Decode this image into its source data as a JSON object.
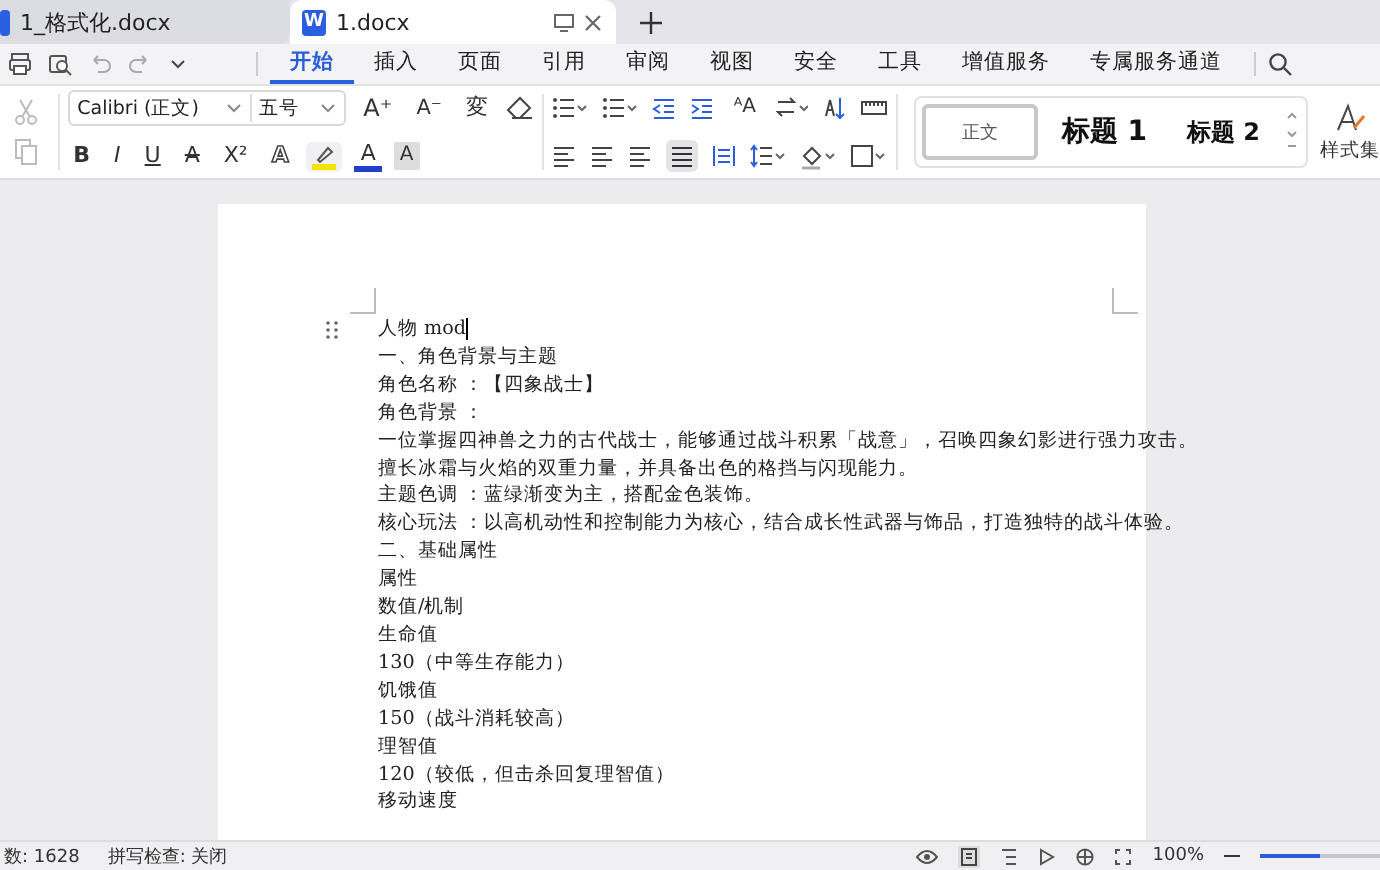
{
  "tabs": [
    {
      "label": "1_格式化.docx",
      "selected": false
    },
    {
      "label": "1.docx",
      "selected": true,
      "icon_letter": "W"
    }
  ],
  "menu": [
    {
      "label": "开始",
      "selected": true
    },
    {
      "label": "插入",
      "selected": false
    },
    {
      "label": "页面",
      "selected": false
    },
    {
      "label": "引用",
      "selected": false
    },
    {
      "label": "审阅",
      "selected": false
    },
    {
      "label": "视图",
      "selected": false
    },
    {
      "label": "安全",
      "selected": false
    },
    {
      "label": "工具",
      "selected": false
    },
    {
      "label": "增值服务",
      "selected": false
    },
    {
      "label": "专属服务通道",
      "selected": false
    }
  ],
  "font": {
    "family": "Calibri (正文)",
    "size": "五号"
  },
  "font_row_1": [
    {
      "kind": "grow",
      "label": "A⁺"
    },
    {
      "kind": "shrink",
      "label": "A⁻"
    },
    {
      "kind": "phonetic",
      "label": "変"
    }
  ],
  "font_row_2": [
    {
      "kind": "bold",
      "label": "B"
    },
    {
      "kind": "italic",
      "label": "I"
    },
    {
      "kind": "underline",
      "label": "U"
    },
    {
      "kind": "strike",
      "label": "A"
    },
    {
      "kind": "superscript",
      "label": "X²"
    },
    {
      "kind": "outline",
      "label": "A"
    },
    {
      "kind": "color",
      "label": "A"
    },
    {
      "kind": "shade",
      "label": "A"
    }
  ],
  "paragraph_row_1": [
    {
      "kind": "fontsize",
      "label": "ᴬA"
    }
  ],
  "styles": [
    {
      "label": "正文",
      "kind": "body",
      "selected": true
    },
    {
      "label": "标题 1",
      "kind": "h1",
      "selected": false
    },
    {
      "label": "标题 2",
      "kind": "h2",
      "selected": false
    }
  ],
  "style_set": "样式集",
  "document": {
    "lines": [
      "人物 mod",
      "一、角色背景与主题",
      "角色名称 ：【四象战士】",
      "角色背景 ：",
      "一位掌握四神兽之力的古代战士，能够通过战斗积累「战意」，召唤四象幻影进行强力攻击。",
      "擅长冰霜与火焰的双重力量，并具备出色的格挡与闪现能力。",
      "主题色调 ：蓝绿渐变为主，搭配金色装饰。",
      "核心玩法 ：以高机动性和控制能力为核心，结合成长性武器与饰品，打造独特的战斗体验。",
      "二、基础属性",
      "属性",
      "数值/机制",
      "生命值",
      "130（中等生存能力）",
      "饥饿值",
      "150（战斗消耗较高）",
      "理智值",
      "120（较低，但击杀回复理智值）",
      "移动速度"
    ]
  },
  "status": {
    "word_count": "数: 1628",
    "spell_check": "拼写检查: 关闭",
    "zoom": "100%",
    "zoom_slider": {
      "level": 0.5
    }
  }
}
